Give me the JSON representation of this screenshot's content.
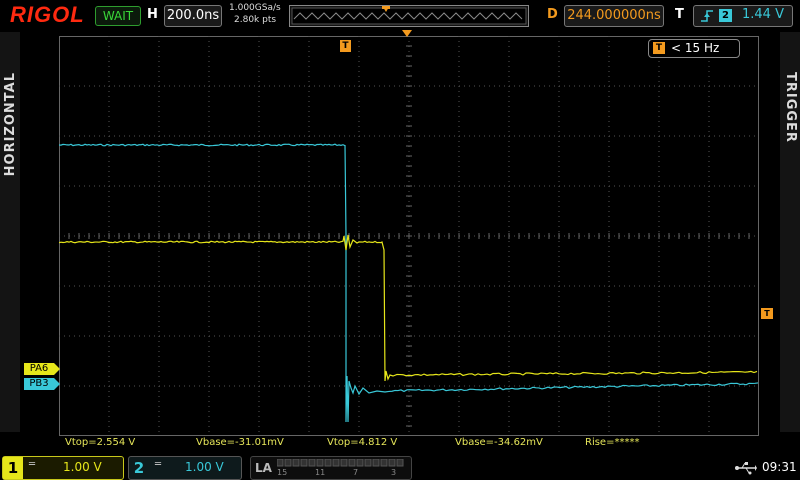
{
  "header": {
    "brand": "RIGOL",
    "run_state": "WAIT",
    "horizontal_label": "H",
    "timebase": "200.0ns",
    "sample_rate": "1.000GSa/s",
    "memory_depth": "2.80k pts",
    "delay_label": "D",
    "delay": "244.000000ns",
    "trigger_label": "T",
    "trigger_source": "2",
    "trigger_level": "1.44 V"
  },
  "side_tabs": {
    "left": "HORIZONTAL",
    "right": "TRIGGER"
  },
  "screen": {
    "frequency_label": "< 15 Hz",
    "trigger_marker": "T",
    "channel_labels": [
      "PA6",
      "PB3"
    ]
  },
  "measurements": [
    "Vtop=2.554 V",
    "Vbase=-31.01mV",
    "Vtop=4.812 V",
    "Vbase=-34.62mV",
    "Rise=*****"
  ],
  "footer": {
    "ch1_num": "1",
    "ch1_scale": "1.00 V",
    "ch2_num": "2",
    "ch2_scale": "1.00 V",
    "la_label": "LA",
    "la_channels": [
      "15",
      "11",
      "7",
      "3"
    ],
    "clock": "09:31"
  },
  "colors": {
    "ch1": "#e6e61a",
    "ch2": "#39c8d8",
    "trigger": "#f39a1e",
    "brand": "#ff2a10"
  },
  "icons": {
    "trigger_edge": "rising-edge-icon",
    "usb": "usb-icon"
  }
}
